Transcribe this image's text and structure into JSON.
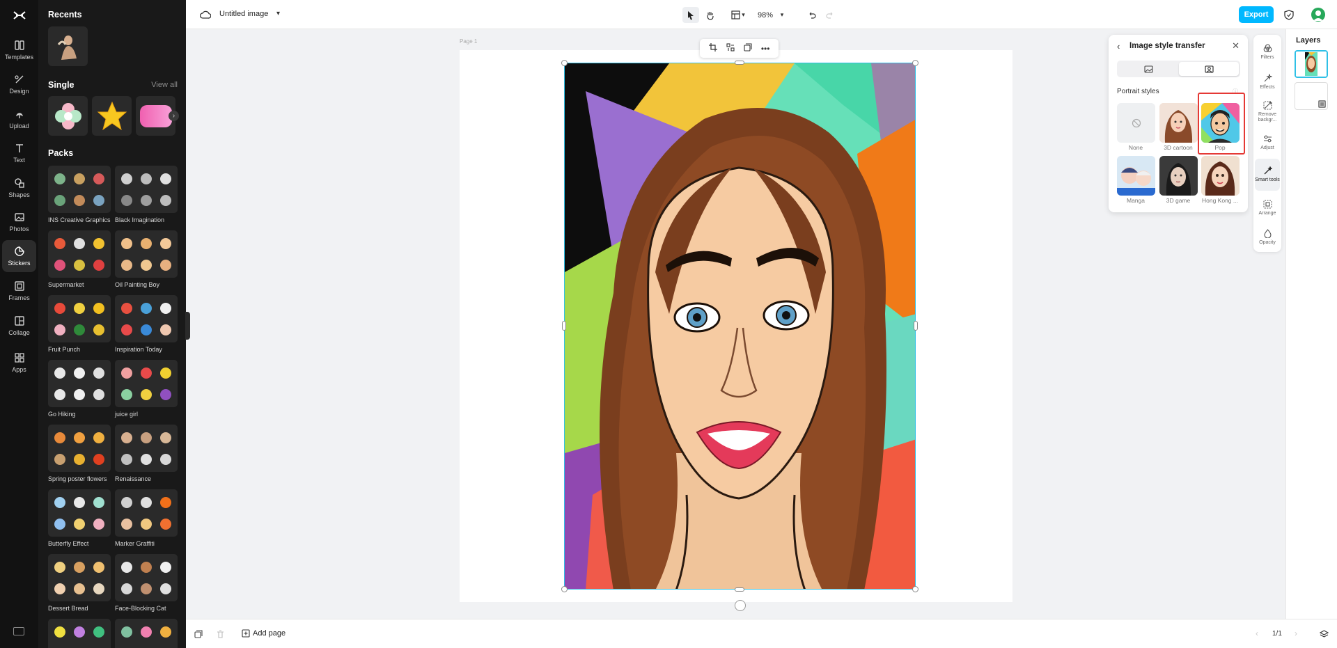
{
  "app": {
    "logo": "capcut-logo",
    "document_title": "Untitled image",
    "zoom": "98%",
    "export_label": "Export"
  },
  "rail": [
    {
      "label": "Templates",
      "icon": "templates-icon"
    },
    {
      "label": "Design",
      "icon": "design-icon"
    },
    {
      "label": "Upload",
      "icon": "upload-icon"
    },
    {
      "label": "Text",
      "icon": "text-icon"
    },
    {
      "label": "Shapes",
      "icon": "shapes-icon"
    },
    {
      "label": "Photos",
      "icon": "photos-icon"
    },
    {
      "label": "Stickers",
      "icon": "stickers-icon",
      "active": true
    },
    {
      "label": "Frames",
      "icon": "frames-icon"
    },
    {
      "label": "Collage",
      "icon": "collage-icon"
    },
    {
      "label": "Apps",
      "icon": "apps-icon"
    }
  ],
  "stickers": {
    "recents_title": "Recents",
    "single_title": "Single",
    "view_all": "View all",
    "packs_title": "Packs",
    "packs": [
      {
        "name": "INS Creative Graphics",
        "colors": [
          "#7db38a",
          "#c8a060",
          "#d65a5a",
          "#6aa37a",
          "#c28b5a",
          "#7aa3c0"
        ]
      },
      {
        "name": "Black Imagination",
        "colors": [
          "#cfcfcf",
          "#bdbdbd",
          "#e0e0e0",
          "#888888",
          "#9e9e9e",
          "#bdbdbd"
        ]
      },
      {
        "name": "Supermarket",
        "colors": [
          "#e85a3a",
          "#e0e0e0",
          "#f2c230",
          "#e0527a",
          "#d8c040",
          "#e04040"
        ]
      },
      {
        "name": "Oil Painting Boy",
        "colors": [
          "#f0c08a",
          "#e8b070",
          "#f2c898",
          "#e8b888",
          "#f0c890",
          "#e8b080"
        ]
      },
      {
        "name": "Fruit Punch",
        "colors": [
          "#e84a3a",
          "#f0d040",
          "#f2c020",
          "#f0b0c0",
          "#2f8a3a",
          "#e8c030"
        ]
      },
      {
        "name": "Inspiration Today",
        "colors": [
          "#e85040",
          "#4aa0d8",
          "#f0f0f0",
          "#e84a4a",
          "#3a8ad8",
          "#f0c8b0"
        ]
      },
      {
        "name": "Go Hiking",
        "colors": [
          "#e8e8e8",
          "#f0f0f0",
          "#e0e0e0",
          "#e8e8e8",
          "#f0f0f0",
          "#e0e0e0"
        ]
      },
      {
        "name": "juice girl",
        "colors": [
          "#f0a0a0",
          "#e84a4a",
          "#f0d030",
          "#8ad0a0",
          "#f0d040",
          "#9050c0"
        ]
      },
      {
        "name": "Spring poster flowers",
        "colors": [
          "#e88a3a",
          "#f0a040",
          "#f0b040",
          "#c8a070",
          "#e8b030",
          "#e04020"
        ]
      },
      {
        "name": "Renaissance",
        "colors": [
          "#d8b090",
          "#c8a080",
          "#d8b898",
          "#c0c0c0",
          "#e0e0e0",
          "#d8d8d8"
        ]
      },
      {
        "name": "Butterfly Effect",
        "colors": [
          "#a0d0f0",
          "#e8e8e8",
          "#a0e0d0",
          "#90c0f0",
          "#f0d070",
          "#f0b0c0"
        ]
      },
      {
        "name": "Marker Graffiti",
        "colors": [
          "#d0d0d0",
          "#e0e0e0",
          "#f0701a",
          "#e8c0a0",
          "#f0c880",
          "#f07030"
        ]
      },
      {
        "name": "Dessert Bread",
        "colors": [
          "#f0d080",
          "#d8a060",
          "#f0c070",
          "#f0d0b0",
          "#e8c090",
          "#e8d8c0"
        ]
      },
      {
        "name": "Face-Blocking Cat",
        "colors": [
          "#e8e8e8",
          "#c08050",
          "#f0f0f0",
          "#d8d8d8",
          "#c09070",
          "#e0e0e0"
        ]
      },
      {
        "name": "",
        "colors": [
          "#f0e040",
          "#c080e0",
          "#40c080",
          "#a0c0e0",
          "#f080c0",
          "#f0a040"
        ]
      },
      {
        "name": "",
        "colors": [
          "#80c0a0",
          "#f080b0",
          "#f0b040",
          "#a0a0f0",
          "#f0c040",
          "#f09080"
        ]
      }
    ]
  },
  "canvas": {
    "page_label": "Page 1",
    "selection_tools": [
      "crop-icon",
      "flip-icon",
      "duplicate-icon",
      "more-icon"
    ]
  },
  "style_panel": {
    "title": "Image style transfer",
    "section": "Portrait styles",
    "styles": [
      {
        "label": "None"
      },
      {
        "label": "3D cartoon"
      },
      {
        "label": "Pop",
        "selected": true
      },
      {
        "label": "Manga"
      },
      {
        "label": "3D game"
      },
      {
        "label": "Hong Kong ..."
      }
    ]
  },
  "tools": [
    {
      "label": "Filters",
      "icon": "filters-icon"
    },
    {
      "label": "Effects",
      "icon": "effects-icon"
    },
    {
      "label": "Remove backgr...",
      "icon": "remove-background-icon"
    },
    {
      "label": "Adjust",
      "icon": "adjust-icon"
    },
    {
      "label": "Smart tools",
      "icon": "smart-tools-icon",
      "active": true
    },
    {
      "label": "Arrange",
      "icon": "arrange-icon"
    },
    {
      "label": "Opacity",
      "icon": "opacity-icon"
    }
  ],
  "layers": {
    "title": "Layers"
  },
  "bottom": {
    "add_page": "Add page",
    "page_count": "1/1"
  }
}
